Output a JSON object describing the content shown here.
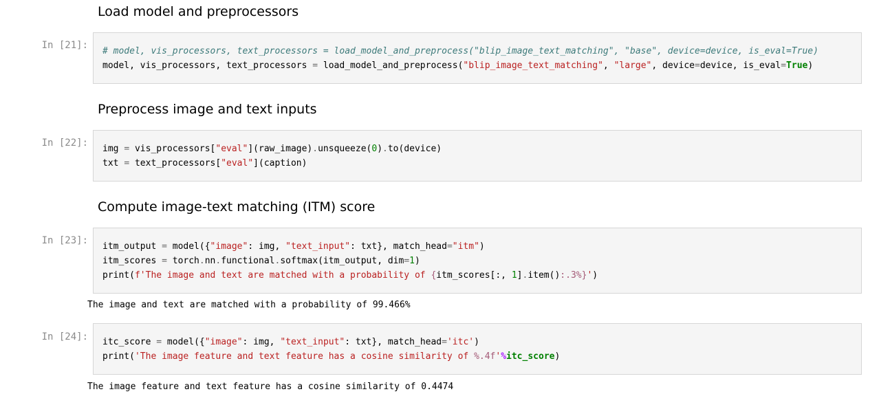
{
  "cells": [
    {
      "heading": "Load model and preprocessors",
      "prompt": "In [21]:",
      "lines": [
        "# model, vis_processors, text_processors = load_model_and_preprocess(\"blip_image_text_matching\", \"base\", device=device, is_eval=True)",
        "model, vis_processors, text_processors = load_model_and_preprocess(\"blip_image_text_matching\", \"large\", device=device, is_eval=True)"
      ]
    },
    {
      "heading": "Preprocess image and text inputs",
      "prompt": "In [22]:",
      "lines": [
        "img = vis_processors[\"eval\"](raw_image).unsqueeze(0).to(device)",
        "txt = text_processors[\"eval\"](caption)"
      ]
    },
    {
      "heading": "Compute image-text matching (ITM) score",
      "prompt": "In [23]:",
      "lines": [
        "itm_output = model({\"image\": img, \"text_input\": txt}, match_head=\"itm\")",
        "itm_scores = torch.nn.functional.softmax(itm_output, dim=1)",
        "print(f'The image and text are matched with a probability of {itm_scores[:, 1].item():.3%}')"
      ],
      "output": "The image and text are matched with a probability of 99.466%"
    },
    {
      "prompt": "In [24]:",
      "lines": [
        "itc_score = model({\"image\": img, \"text_input\": txt}, match_head='itc')",
        "print('The image feature and text feature has a cosine similarity of %.4f'%itc_score)"
      ],
      "output": "The image feature and text feature has a cosine similarity of 0.4474"
    }
  ]
}
